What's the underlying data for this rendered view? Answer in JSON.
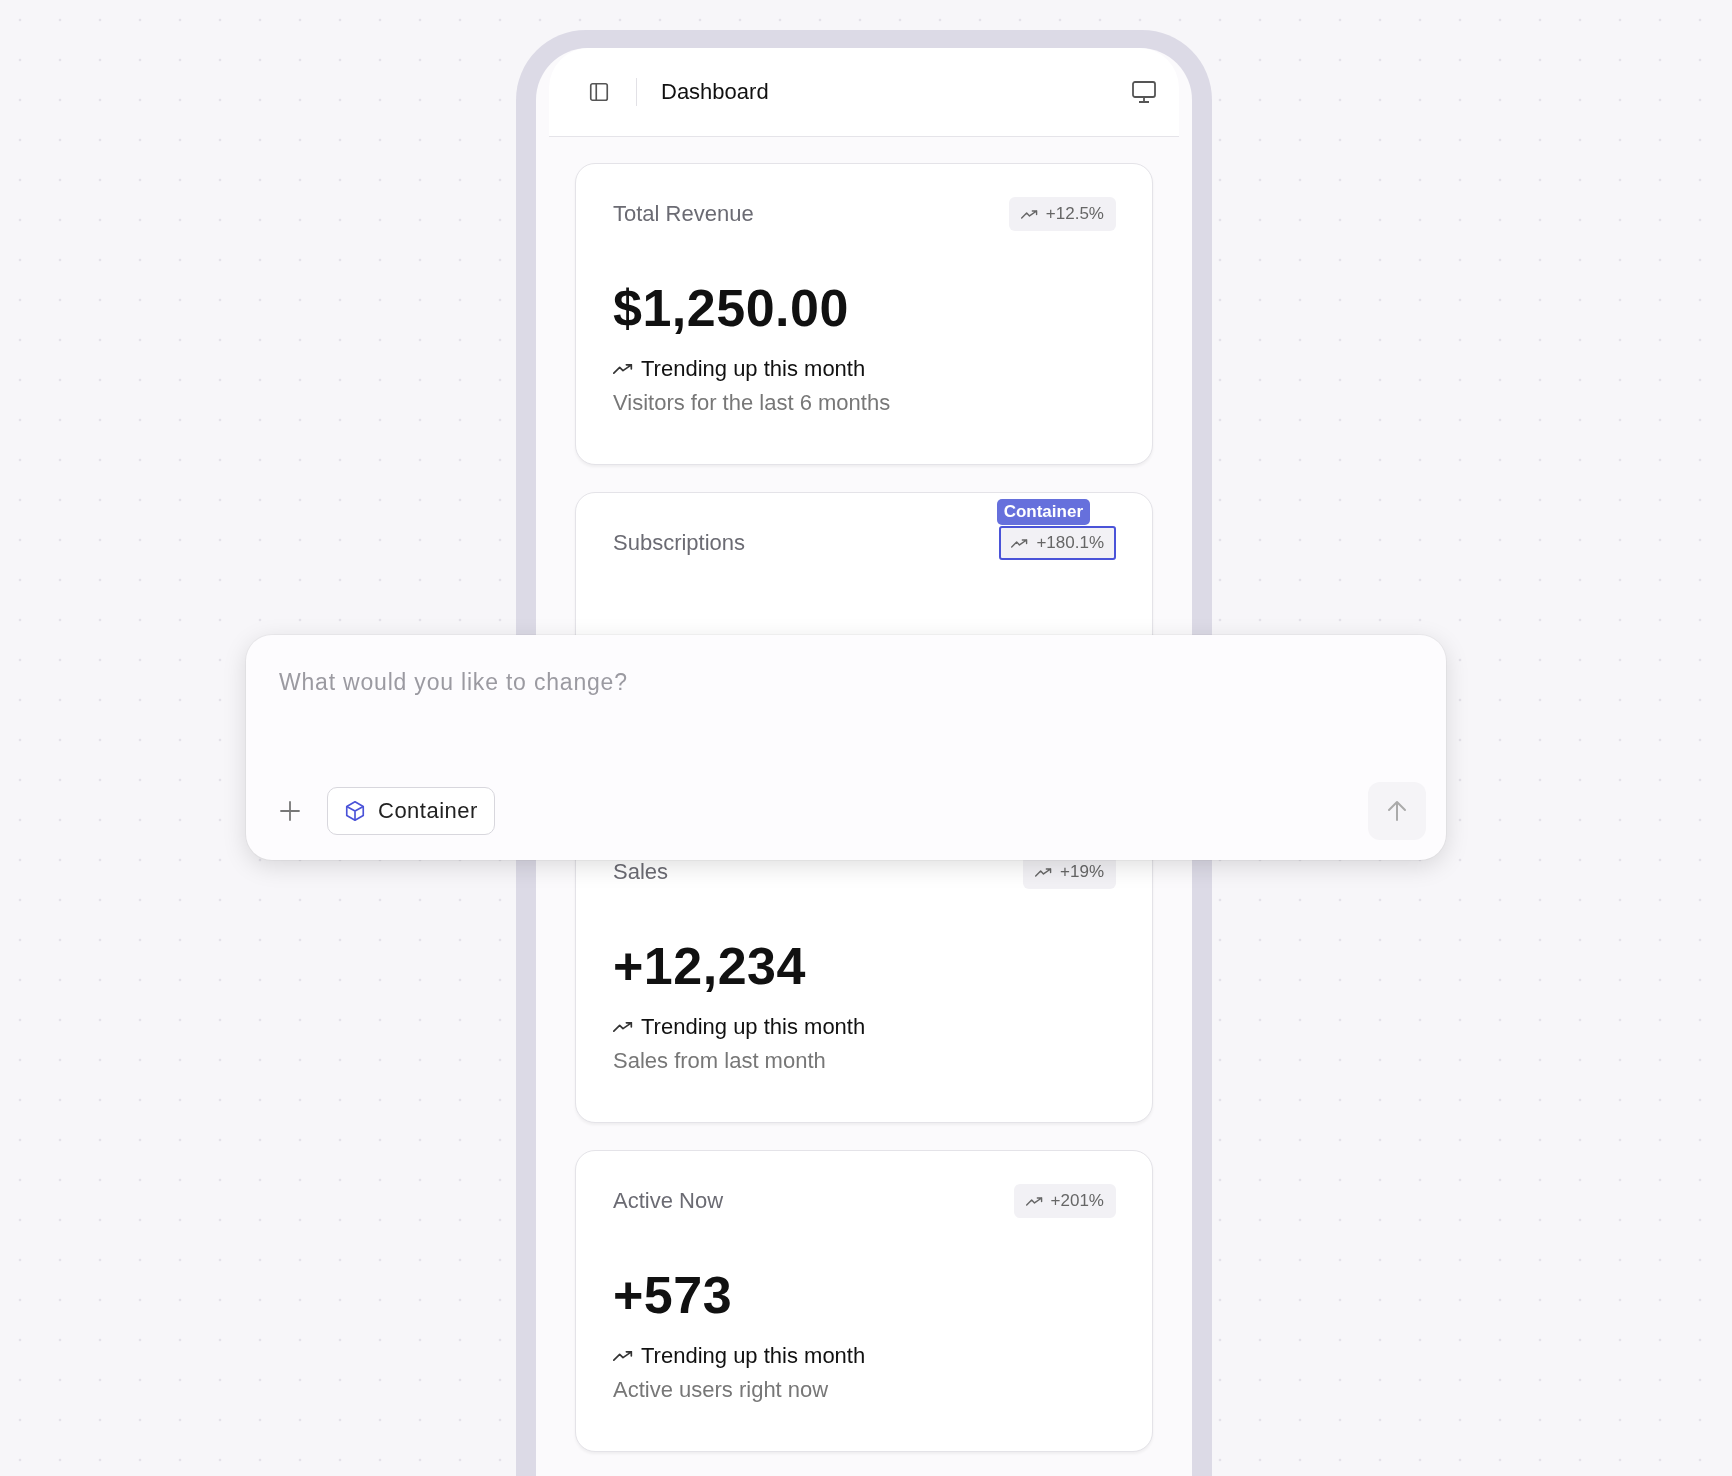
{
  "header": {
    "title": "Dashboard"
  },
  "cards": [
    {
      "title": "Total Revenue",
      "badge": "+12.5%",
      "badge_selected": false,
      "value": "$1,250.00",
      "trend": "Trending up this month",
      "note": "Visitors for the last 6 months"
    },
    {
      "title": "Subscriptions",
      "badge": "+180.1%",
      "badge_selected": true,
      "selection_label": "Container"
    },
    {
      "title": "Sales",
      "badge": "+19%",
      "badge_selected": false,
      "value": "+12,234",
      "trend": "Trending up this month",
      "note": "Sales from last month"
    },
    {
      "title": "Active Now",
      "badge": "+201%",
      "badge_selected": false,
      "value": "+573",
      "trend": "Trending up this month",
      "note": "Active users right now"
    }
  ],
  "prompt": {
    "placeholder": "What would you like to change?",
    "chip": "Container"
  }
}
